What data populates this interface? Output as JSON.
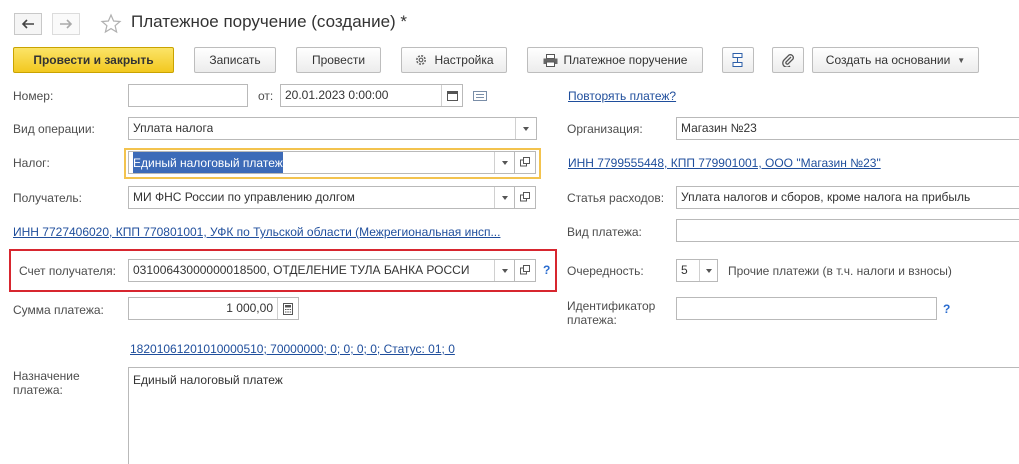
{
  "window": {
    "title": "Платежное поручение (создание) *"
  },
  "toolbar": {
    "post_close": "Провести и закрыть",
    "save": "Записать",
    "post": "Провести",
    "settings": "Настройка",
    "print": "Платежное поручение",
    "create_based": "Создать на основании"
  },
  "form": {
    "number_label": "Номер:",
    "number_value": "",
    "date_label": "от:",
    "date_value": "20.01.2023  0:00:00",
    "repeat_link": "Повторять платеж?",
    "operation_label": "Вид операции:",
    "operation_value": "Уплата налога",
    "org_label": "Организация:",
    "org_value": "Магазин №23",
    "tax_label": "Налог:",
    "tax_value": "Единый налоговый платеж",
    "org_inn_link": "ИНН 7799555448, КПП 779901001, ООО \"Магазин №23\"",
    "recipient_label": "Получатель:",
    "recipient_value": "МИ ФНС России по управлению долгом",
    "expense_label": "Статья расходов:",
    "expense_value": "Уплата налогов и сборов, кроме налога на прибыль",
    "recipient_inn_link": "ИНН 7727406020, КПП 770801001, УФК по Тульской области (Межрегиональная инсп...",
    "payment_kind_label": "Вид платежа:",
    "payment_kind_value": "",
    "account_label": "Счет получателя:",
    "account_value": "03100643000000018500, ОТДЕЛЕНИЕ ТУЛА БАНКА РОССИ",
    "help_mark": "?",
    "priority_label": "Очередность:",
    "priority_value": "5",
    "priority_desc": "Прочие платежи (в т.ч. налоги и взносы)",
    "amount_label": "Сумма платежа:",
    "amount_value": "1 000,00",
    "identifier_label": "Идентификатор платежа:",
    "identifier_value": "",
    "kbk_link": "18201061201010000510; 70000000; 0; 0; 0; 0; Статус: 01; 0",
    "purpose_label": "Назначение платежа:",
    "purpose_value": "Единый налоговый платеж"
  },
  "colors": {
    "accent_yellow": "#f2c81f",
    "link_blue": "#1f4e9c",
    "highlight_red": "#d7262f",
    "focus_orange": "#f3c34e"
  }
}
